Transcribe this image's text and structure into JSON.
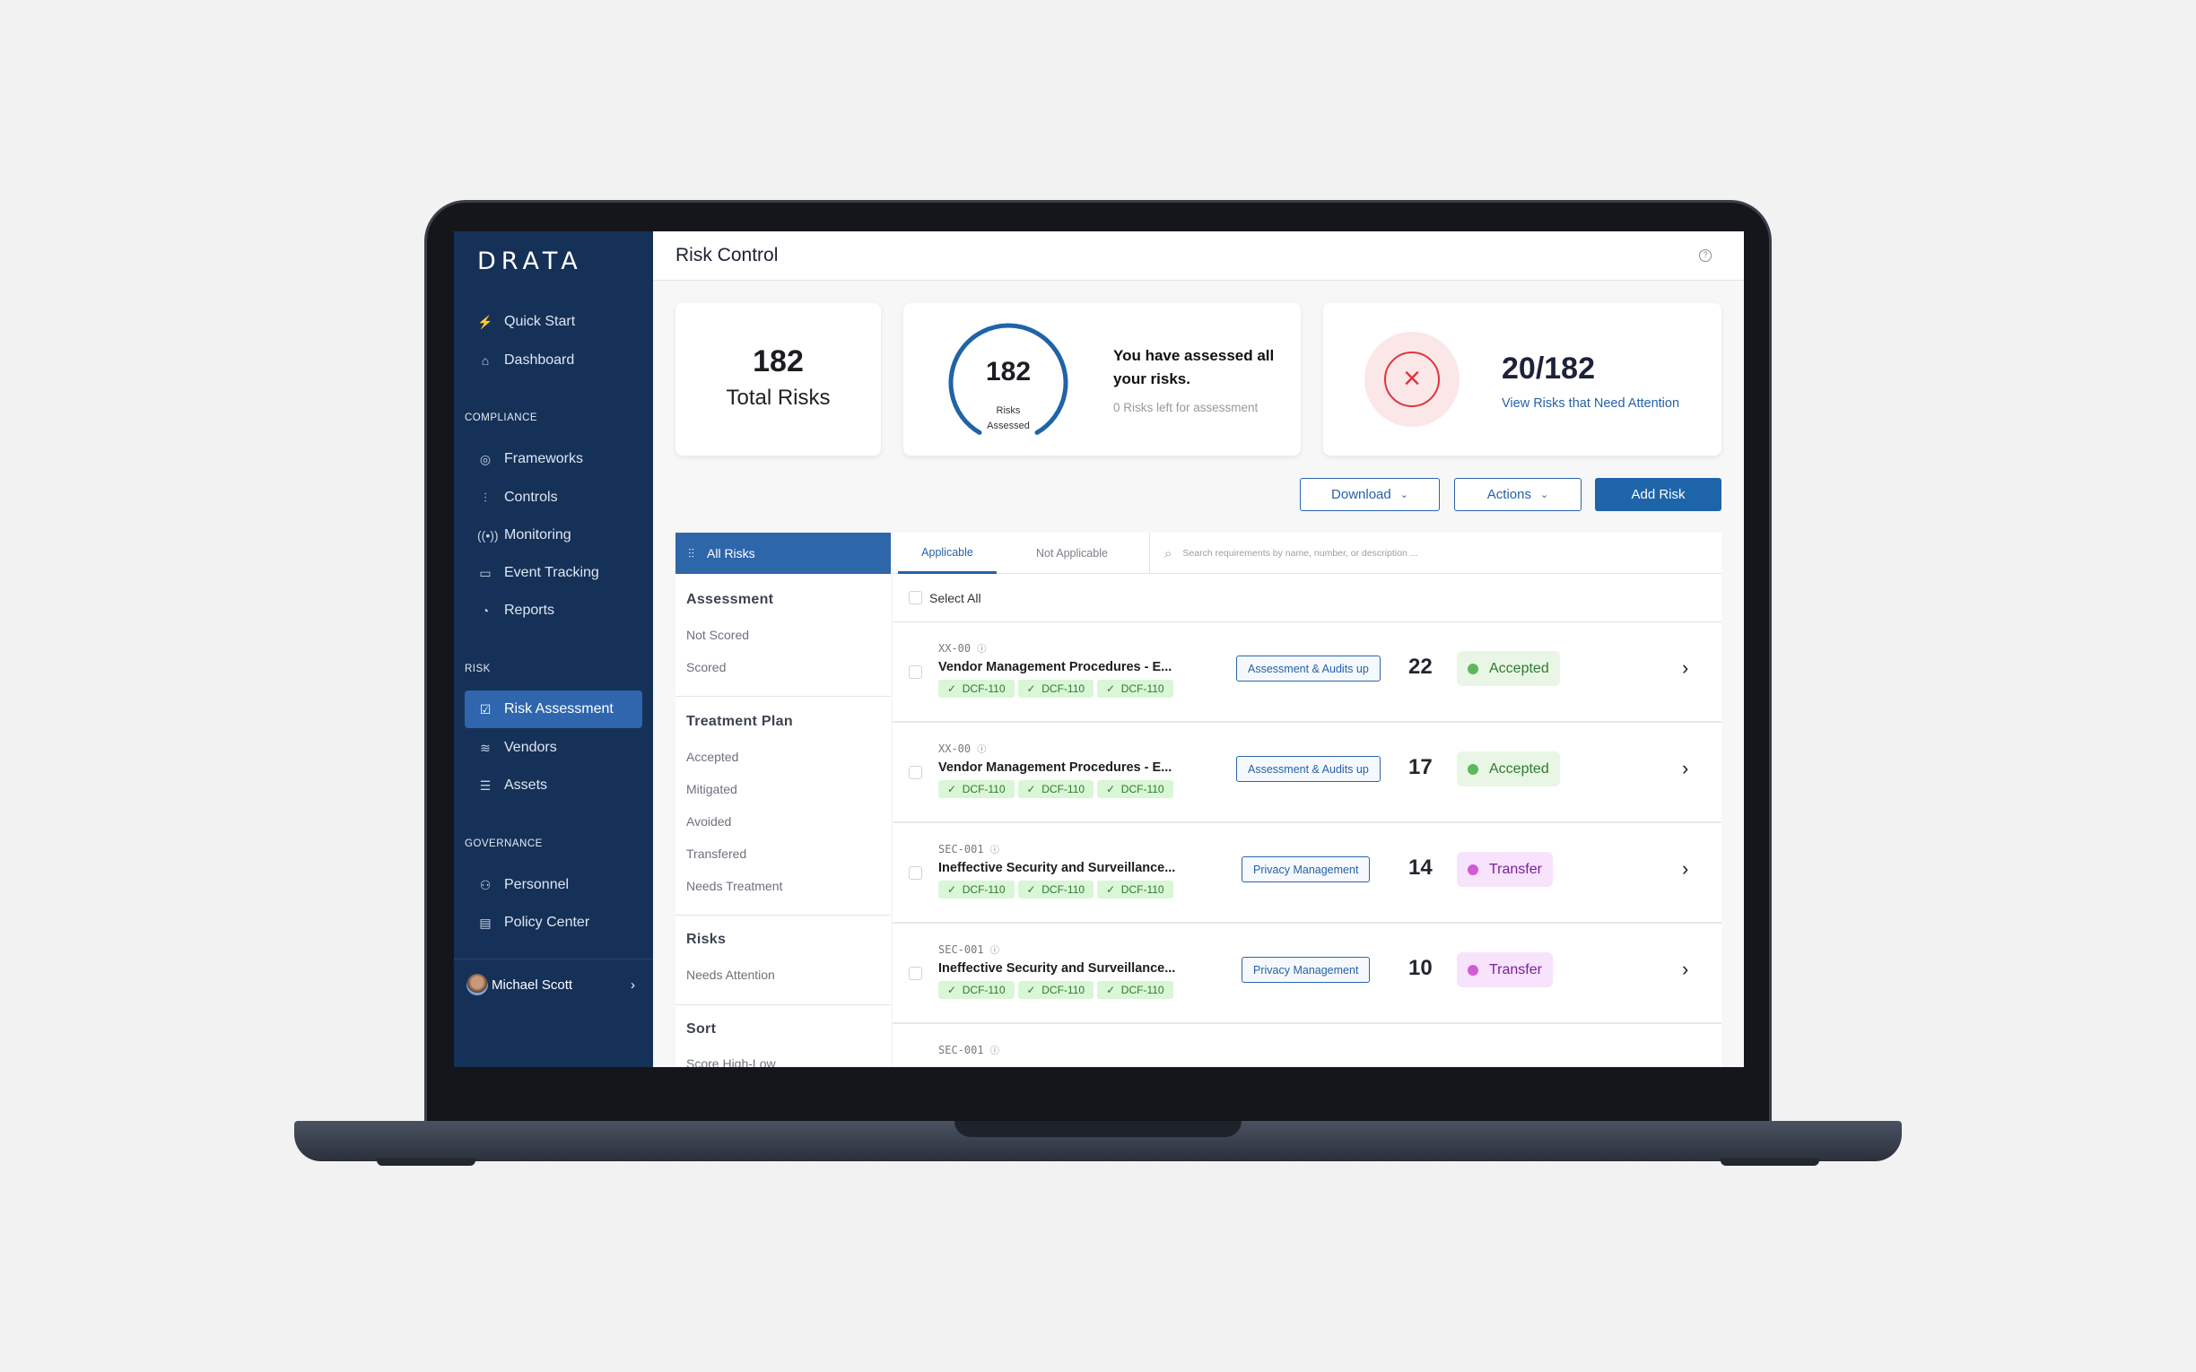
{
  "sidebar": {
    "logo": "DRATA",
    "top_items": [
      {
        "label": "Quick Start",
        "icon": "bolt-icon"
      },
      {
        "label": "Dashboard",
        "icon": "home-icon"
      }
    ],
    "compliance_label": "COMPLIANCE",
    "compliance_items": [
      {
        "label": "Frameworks",
        "icon": "frameworks-icon"
      },
      {
        "label": "Controls",
        "icon": "sliders-icon"
      },
      {
        "label": "Monitoring",
        "icon": "broadcast-icon"
      },
      {
        "label": "Event Tracking",
        "icon": "calendar-icon"
      },
      {
        "label": "Reports",
        "icon": "pie-chart-icon"
      }
    ],
    "risk_label": "RISK",
    "risk_items": [
      {
        "label": "Risk Assessment",
        "icon": "checkbox-icon",
        "active": true
      },
      {
        "label": "Vendors",
        "icon": "layers-icon"
      },
      {
        "label": "Assets",
        "icon": "list-icon"
      }
    ],
    "governance_label": "GOVERNANCE",
    "governance_items": [
      {
        "label": "Personnel",
        "icon": "users-icon"
      },
      {
        "label": "Policy Center",
        "icon": "document-icon"
      }
    ],
    "user": {
      "name": "Michael Scott"
    }
  },
  "header": {
    "title": "Risk Control"
  },
  "cards": {
    "total": {
      "value": "182",
      "label": "Total Risks"
    },
    "assessed": {
      "value": "182",
      "label": "Risks Assessed",
      "progress": 1.0,
      "headline": "You have assessed all your risks.",
      "sub": "0 Risks left for assessment"
    },
    "attention": {
      "value": "20/182",
      "link": "View Risks that Need Attention"
    }
  },
  "toolbar": {
    "download": "Download",
    "actions": "Actions",
    "add": "Add Risk"
  },
  "filters": {
    "all": "All Risks",
    "assessment": {
      "title": "Assessment",
      "items": [
        "Not Scored",
        "Scored"
      ]
    },
    "treatment": {
      "title": "Treatment Plan",
      "items": [
        "Accepted",
        "Mitigated",
        "Avoided",
        "Transfered",
        "Needs Treatment"
      ]
    },
    "risks": {
      "title": "Risks",
      "items": [
        "Needs Attention"
      ]
    },
    "sort": {
      "title": "Sort",
      "items": [
        "Score High-Low"
      ]
    }
  },
  "list": {
    "tabs": [
      "Applicable",
      "Not Applicable"
    ],
    "search_placeholder": "Search requirements by name, number, or description ...",
    "select_all": "Select All",
    "rows": [
      {
        "id": "XX-00",
        "name": "Vendor Management Procedures - E...",
        "tags": [
          "DCF-110",
          "DCF-110",
          "DCF-110"
        ],
        "category": "Assessment & Audits up",
        "score": "22",
        "status": "Accepted"
      },
      {
        "id": "XX-00",
        "name": "Vendor Management Procedures - E...",
        "tags": [
          "DCF-110",
          "DCF-110",
          "DCF-110"
        ],
        "category": "Assessment & Audits up",
        "score": "17",
        "status": "Accepted"
      },
      {
        "id": "SEC-001",
        "name": "Ineffective Security and Surveillance...",
        "tags": [
          "DCF-110",
          "DCF-110",
          "DCF-110"
        ],
        "category": "Privacy Management",
        "score": "14",
        "status": "Transfer"
      },
      {
        "id": "SEC-001",
        "name": "Ineffective Security and Surveillance...",
        "tags": [
          "DCF-110",
          "DCF-110",
          "DCF-110"
        ],
        "category": "Privacy Management",
        "score": "10",
        "status": "Transfer"
      },
      {
        "id": "SEC-001"
      }
    ]
  },
  "colors": {
    "sidebar": "#163158",
    "accent": "#2562a8",
    "accepted_bg": "#e9f6e6",
    "accepted_text": "#2e7a2e",
    "transfer_bg": "#f7e3fb",
    "transfer_text": "#7a1f9b",
    "danger": "#e0343f"
  }
}
